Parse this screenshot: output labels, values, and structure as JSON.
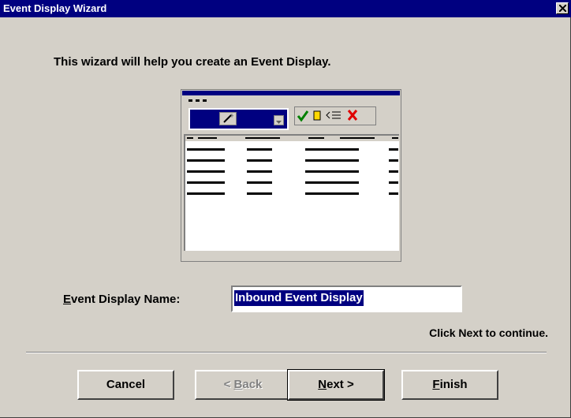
{
  "window": {
    "title": "Event Display Wizard"
  },
  "intro": "This wizard will help you create an Event Display.",
  "name_field": {
    "label_mnemonic": "E",
    "label_rest": "vent Display Name:",
    "value": "Inbound Event Display"
  },
  "hint": "Click Next to continue.",
  "buttons": {
    "cancel": "Cancel",
    "back_arrow": "< ",
    "back_mnemonic": "B",
    "back_rest": "ack",
    "next_mnemonic": "N",
    "next_rest": "ext >",
    "finish_mnemonic": "F",
    "finish_rest": "inish"
  },
  "colors": {
    "face": "#d4d0c8",
    "titlebar": "#000080",
    "selection": "#000080"
  },
  "icons": [
    "close-icon",
    "wand-icon",
    "check-icon",
    "hand-icon",
    "list-icon",
    "delete-icon"
  ]
}
